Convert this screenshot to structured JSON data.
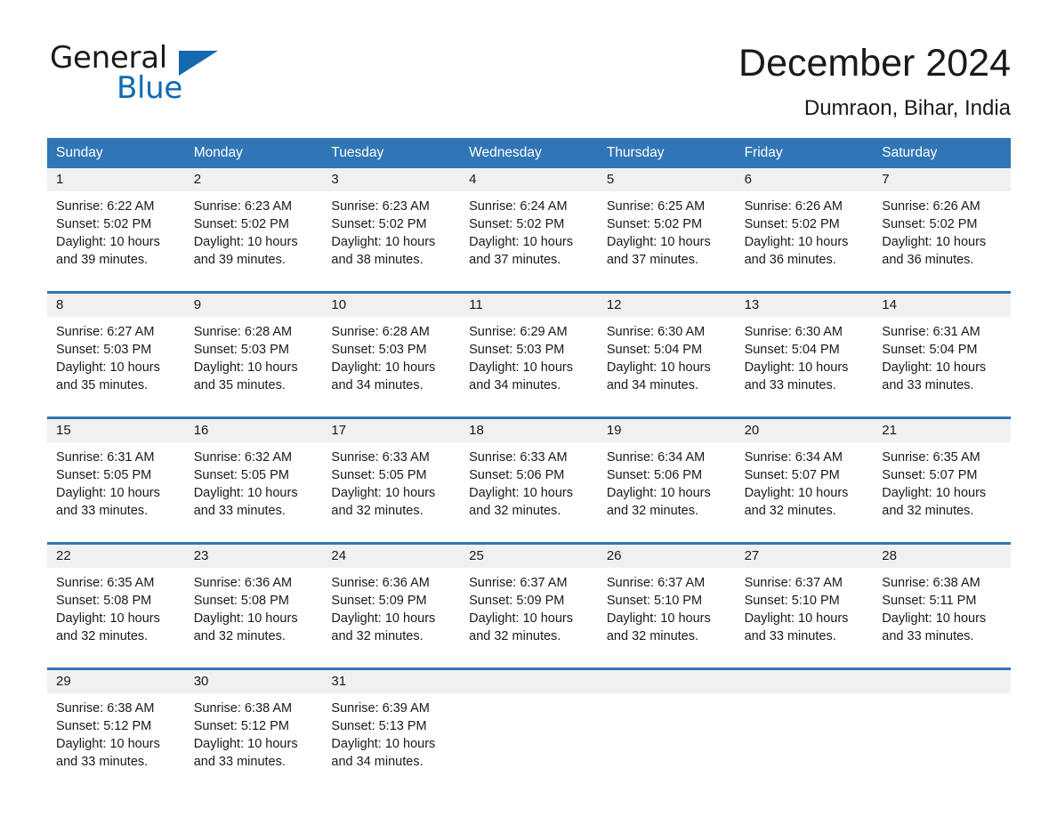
{
  "brand": {
    "name_top": "General",
    "name_bottom": "Blue",
    "triangle_color": "#1468ad",
    "blue_text_color": "#0e6bb5"
  },
  "header": {
    "title": "December 2024",
    "location": "Dumraon, Bihar, India"
  },
  "theme": {
    "header_blue": "#3076b6",
    "date_band_gray": "#f0f0f0",
    "page_background": "#ffffff",
    "text_color": "#1a1a1a"
  },
  "calendar": {
    "day_headers": [
      "Sunday",
      "Monday",
      "Tuesday",
      "Wednesday",
      "Thursday",
      "Friday",
      "Saturday"
    ],
    "weeks": [
      {
        "days": [
          {
            "date": "1",
            "sunrise": "Sunrise: 6:22 AM",
            "sunset": "Sunset: 5:02 PM",
            "daylight": "Daylight: 10 hours and 39 minutes."
          },
          {
            "date": "2",
            "sunrise": "Sunrise: 6:23 AM",
            "sunset": "Sunset: 5:02 PM",
            "daylight": "Daylight: 10 hours and 39 minutes."
          },
          {
            "date": "3",
            "sunrise": "Sunrise: 6:23 AM",
            "sunset": "Sunset: 5:02 PM",
            "daylight": "Daylight: 10 hours and 38 minutes."
          },
          {
            "date": "4",
            "sunrise": "Sunrise: 6:24 AM",
            "sunset": "Sunset: 5:02 PM",
            "daylight": "Daylight: 10 hours and 37 minutes."
          },
          {
            "date": "5",
            "sunrise": "Sunrise: 6:25 AM",
            "sunset": "Sunset: 5:02 PM",
            "daylight": "Daylight: 10 hours and 37 minutes."
          },
          {
            "date": "6",
            "sunrise": "Sunrise: 6:26 AM",
            "sunset": "Sunset: 5:02 PM",
            "daylight": "Daylight: 10 hours and 36 minutes."
          },
          {
            "date": "7",
            "sunrise": "Sunrise: 6:26 AM",
            "sunset": "Sunset: 5:02 PM",
            "daylight": "Daylight: 10 hours and 36 minutes."
          }
        ]
      },
      {
        "days": [
          {
            "date": "8",
            "sunrise": "Sunrise: 6:27 AM",
            "sunset": "Sunset: 5:03 PM",
            "daylight": "Daylight: 10 hours and 35 minutes."
          },
          {
            "date": "9",
            "sunrise": "Sunrise: 6:28 AM",
            "sunset": "Sunset: 5:03 PM",
            "daylight": "Daylight: 10 hours and 35 minutes."
          },
          {
            "date": "10",
            "sunrise": "Sunrise: 6:28 AM",
            "sunset": "Sunset: 5:03 PM",
            "daylight": "Daylight: 10 hours and 34 minutes."
          },
          {
            "date": "11",
            "sunrise": "Sunrise: 6:29 AM",
            "sunset": "Sunset: 5:03 PM",
            "daylight": "Daylight: 10 hours and 34 minutes."
          },
          {
            "date": "12",
            "sunrise": "Sunrise: 6:30 AM",
            "sunset": "Sunset: 5:04 PM",
            "daylight": "Daylight: 10 hours and 34 minutes."
          },
          {
            "date": "13",
            "sunrise": "Sunrise: 6:30 AM",
            "sunset": "Sunset: 5:04 PM",
            "daylight": "Daylight: 10 hours and 33 minutes."
          },
          {
            "date": "14",
            "sunrise": "Sunrise: 6:31 AM",
            "sunset": "Sunset: 5:04 PM",
            "daylight": "Daylight: 10 hours and 33 minutes."
          }
        ]
      },
      {
        "days": [
          {
            "date": "15",
            "sunrise": "Sunrise: 6:31 AM",
            "sunset": "Sunset: 5:05 PM",
            "daylight": "Daylight: 10 hours and 33 minutes."
          },
          {
            "date": "16",
            "sunrise": "Sunrise: 6:32 AM",
            "sunset": "Sunset: 5:05 PM",
            "daylight": "Daylight: 10 hours and 33 minutes."
          },
          {
            "date": "17",
            "sunrise": "Sunrise: 6:33 AM",
            "sunset": "Sunset: 5:05 PM",
            "daylight": "Daylight: 10 hours and 32 minutes."
          },
          {
            "date": "18",
            "sunrise": "Sunrise: 6:33 AM",
            "sunset": "Sunset: 5:06 PM",
            "daylight": "Daylight: 10 hours and 32 minutes."
          },
          {
            "date": "19",
            "sunrise": "Sunrise: 6:34 AM",
            "sunset": "Sunset: 5:06 PM",
            "daylight": "Daylight: 10 hours and 32 minutes."
          },
          {
            "date": "20",
            "sunrise": "Sunrise: 6:34 AM",
            "sunset": "Sunset: 5:07 PM",
            "daylight": "Daylight: 10 hours and 32 minutes."
          },
          {
            "date": "21",
            "sunrise": "Sunrise: 6:35 AM",
            "sunset": "Sunset: 5:07 PM",
            "daylight": "Daylight: 10 hours and 32 minutes."
          }
        ]
      },
      {
        "days": [
          {
            "date": "22",
            "sunrise": "Sunrise: 6:35 AM",
            "sunset": "Sunset: 5:08 PM",
            "daylight": "Daylight: 10 hours and 32 minutes."
          },
          {
            "date": "23",
            "sunrise": "Sunrise: 6:36 AM",
            "sunset": "Sunset: 5:08 PM",
            "daylight": "Daylight: 10 hours and 32 minutes."
          },
          {
            "date": "24",
            "sunrise": "Sunrise: 6:36 AM",
            "sunset": "Sunset: 5:09 PM",
            "daylight": "Daylight: 10 hours and 32 minutes."
          },
          {
            "date": "25",
            "sunrise": "Sunrise: 6:37 AM",
            "sunset": "Sunset: 5:09 PM",
            "daylight": "Daylight: 10 hours and 32 minutes."
          },
          {
            "date": "26",
            "sunrise": "Sunrise: 6:37 AM",
            "sunset": "Sunset: 5:10 PM",
            "daylight": "Daylight: 10 hours and 32 minutes."
          },
          {
            "date": "27",
            "sunrise": "Sunrise: 6:37 AM",
            "sunset": "Sunset: 5:10 PM",
            "daylight": "Daylight: 10 hours and 33 minutes."
          },
          {
            "date": "28",
            "sunrise": "Sunrise: 6:38 AM",
            "sunset": "Sunset: 5:11 PM",
            "daylight": "Daylight: 10 hours and 33 minutes."
          }
        ]
      },
      {
        "days": [
          {
            "date": "29",
            "sunrise": "Sunrise: 6:38 AM",
            "sunset": "Sunset: 5:12 PM",
            "daylight": "Daylight: 10 hours and 33 minutes."
          },
          {
            "date": "30",
            "sunrise": "Sunrise: 6:38 AM",
            "sunset": "Sunset: 5:12 PM",
            "daylight": "Daylight: 10 hours and 33 minutes."
          },
          {
            "date": "31",
            "sunrise": "Sunrise: 6:39 AM",
            "sunset": "Sunset: 5:13 PM",
            "daylight": "Daylight: 10 hours and 34 minutes."
          },
          {
            "date": "",
            "sunrise": "",
            "sunset": "",
            "daylight": ""
          },
          {
            "date": "",
            "sunrise": "",
            "sunset": "",
            "daylight": ""
          },
          {
            "date": "",
            "sunrise": "",
            "sunset": "",
            "daylight": ""
          },
          {
            "date": "",
            "sunrise": "",
            "sunset": "",
            "daylight": ""
          }
        ]
      }
    ]
  }
}
